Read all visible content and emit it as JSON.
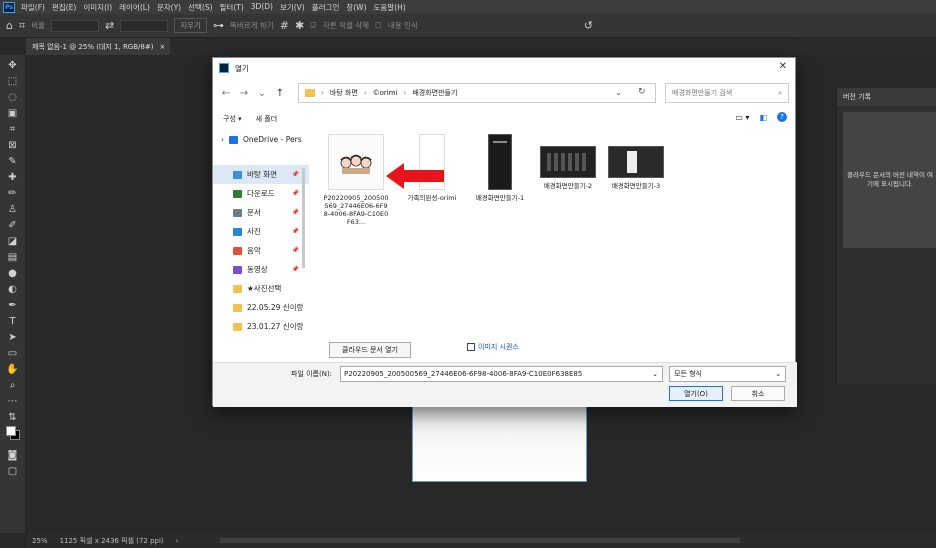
{
  "app": {
    "menu": [
      "파일(F)",
      "편집(E)",
      "이미지(I)",
      "레이어(L)",
      "문자(Y)",
      "선택(S)",
      "필터(T)",
      "3D(D)",
      "보기(V)",
      "플러그인",
      "창(W)",
      "도움말(H)"
    ],
    "options": {
      "ratio_label": "비율",
      "clear_label": "지우기",
      "straighten_label": "똑바르게 하기",
      "delete_pixels_label": "자른 픽셀 삭제",
      "content_aware_label": "내용 인식"
    },
    "doc_tab": "제목 없음-1 @ 25% (대지 1, RGB/8#)",
    "doc_tab_close": "×",
    "history_panel": {
      "title": "버전 기록",
      "message": "클라우드 문서의 버전 내역이 여기에 표시됩니다."
    },
    "status": {
      "zoom": "25%",
      "size": "1125 픽셀 x 2436 픽셀 (72 ppi)"
    }
  },
  "dialog": {
    "title": "열기",
    "breadcrumb": [
      "바탕 화면",
      "©orimi",
      "배경화면만들기"
    ],
    "search_placeholder": "배경화면만들기 검색",
    "organize_label": "구성 ▾",
    "new_folder_label": "새 폴더",
    "nav_items": [
      {
        "label": "OneDrive - Pers",
        "type": "cloud"
      },
      {
        "label": "바탕 화면",
        "type": "desktop",
        "selected": true
      },
      {
        "label": "다운로드",
        "type": "download"
      },
      {
        "label": "문서",
        "type": "doc"
      },
      {
        "label": "사진",
        "type": "photo"
      },
      {
        "label": "음악",
        "type": "music"
      },
      {
        "label": "동영상",
        "type": "video"
      },
      {
        "label": "★사진선택",
        "type": "folder"
      },
      {
        "label": "22.05.29 신이랑",
        "type": "folder"
      },
      {
        "label": "23.01.27 신이랑",
        "type": "folder"
      }
    ],
    "files": [
      {
        "name": "P20220905_200500569_27446E06-6F98-4006-8FA9-C10E0F63...",
        "kind": "image"
      },
      {
        "name": "가족의완성-orimi",
        "kind": "doc"
      },
      {
        "name": "배경화면만들기-1",
        "kind": "dark-tall"
      },
      {
        "name": "배경화면만들기-2",
        "kind": "dark-wide"
      },
      {
        "name": "배경화면만들기-3",
        "kind": "dark-wide2"
      }
    ],
    "cloud_button": "클라우드 문서 열기",
    "image_sequence_label": "이미지 시퀀스",
    "filename_label": "파일 이름(N):",
    "filename_value": "P20220905_200500569_27446E06-6F98-4006-8FA9-C10E0F638E85",
    "filetype_value": "모든 형식",
    "open_button": "열기(O)",
    "cancel_button": "취소"
  },
  "colors": {
    "annotation_arrow": "#e8141c",
    "accent": "#1a73e8"
  }
}
